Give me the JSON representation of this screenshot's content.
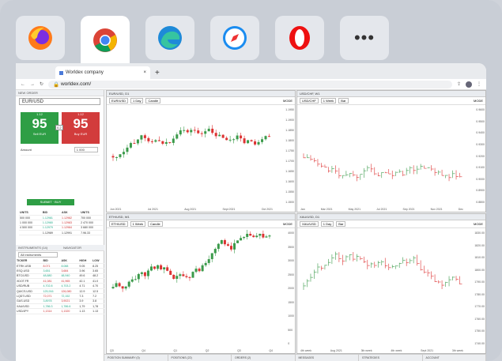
{
  "browser": {
    "tab_title": "Worldex company",
    "url": "worldex.com/"
  },
  "browsers": [
    "firefox",
    "chrome",
    "edge",
    "safari",
    "opera",
    "more"
  ],
  "order": {
    "header": "NEW ORDER",
    "symbol": "EUR/USD",
    "sell_price": "95",
    "buy_price": "95",
    "sell_prefix": "1.12",
    "buy_prefix": "1.12",
    "sell_label": "Sell EUR",
    "buy_label": "Buy EUR",
    "spread": "0.2",
    "amount_label": "Amount",
    "amount": "1 000",
    "submit": "SUBMIT · BUY"
  },
  "charts": [
    {
      "title": "EUR/USD, D1",
      "symbol": "EUR/USD",
      "tf": "1 Day",
      "type": "Candle",
      "mode": "MODE",
      "xlabels": [
        "Jun 2021",
        "Jul 2021",
        "Aug 2021",
        "Sept 2021",
        "Oct 2021"
      ],
      "ylabels": [
        "1.1950",
        "1.1900",
        "1.1850",
        "1.1800",
        "1.1750",
        "1.1700",
        "1.1650",
        "1.1600",
        "1.1550",
        "1.1500"
      ]
    },
    {
      "title": "USD/CHF, W1",
      "symbol": "USD/CHF",
      "tf": "1 Week",
      "type": "Bar",
      "mode": "MODE",
      "xlabels": [
        "Jan",
        "Mar 2021",
        "May 2021",
        "Jul 2021",
        "Sep 2021",
        "Nov 2021",
        "Dec"
      ],
      "ylabels": [
        "0.9600",
        "0.9500",
        "0.9400",
        "0.9300",
        "0.9200",
        "0.9100",
        "0.9000",
        "0.8900",
        "0.8800"
      ]
    },
    {
      "title": "ETH/USD, W1",
      "symbol": "ETH/USD",
      "tf": "1 Week",
      "type": "Candle",
      "mode": "MODE",
      "xlabels": [
        "Q3",
        "Q4",
        "Q1",
        "Q2",
        "Q3",
        "Q4"
      ],
      "ylabels": [
        "4000",
        "3500",
        "3000",
        "2500",
        "2000",
        "1500",
        "1000",
        "500",
        "0"
      ]
    },
    {
      "title": "XAU/USD, D1",
      "symbol": "XAU/USD",
      "tf": "1 Day",
      "type": "Bar",
      "mode": "MODE",
      "xlabels": [
        "4th week",
        "Aug 2021",
        "3th week",
        "4th week",
        "Sept 2021",
        "3th week"
      ],
      "ylabels": [
        "1830.00",
        "1820.00",
        "1810.00",
        "1800.00",
        "1790.00",
        "1780.00",
        "1770.00",
        "1760.00",
        "1750.00",
        "1740.00"
      ]
    }
  ],
  "instruments": {
    "header": "INSTRUMENTS (14)",
    "nav": "NAVIGATOR",
    "filter": "All instruments",
    "cols": [
      "TICKER",
      "BID",
      "ASK",
      "HIGH",
      "LOW"
    ],
    "rows": [
      [
        "ETRK.USB",
        "8.071",
        "8.088",
        "9.05",
        "8.25"
      ],
      [
        "ESQ.USD",
        "3,651",
        "3,684",
        "3.96",
        "3.65"
      ],
      [
        "BTC/USD",
        "48,880",
        "48,940",
        "49.6",
        "48.2"
      ],
      [
        "XDOT.FR",
        "41,081",
        "41,965",
        "42.1",
        "41.0"
      ],
      [
        "USD/RUB",
        "4,702.8",
        "4,703.2",
        "4.71",
        "4.70"
      ],
      [
        "QUICS.USD",
        "125,916",
        "126,080",
        "12.9",
        "12.5"
      ],
      [
        "LQDT.USD",
        "72,071",
        "72,152",
        "7.3",
        "7.2"
      ],
      [
        "GAS.USD",
        "3,8978",
        "3,9021",
        "3.9",
        "3.8"
      ],
      [
        "XAU/USD",
        "1,786.3",
        "1,786.6",
        "1,79",
        "1,78"
      ],
      [
        "USD/JPY",
        "1,1314",
        "1,1320",
        "1.13",
        "1.13"
      ]
    ]
  },
  "depth": {
    "cols": [
      "UNITS",
      "BID",
      "ASK",
      "UNITS"
    ],
    "rows": [
      [
        "500 000",
        "1.12981",
        "1.12982",
        "700 000"
      ],
      [
        "1 000 000",
        "1.12980",
        "1.12983",
        "2 470 000"
      ],
      [
        "4 500 000",
        "1.12979",
        "1.12984",
        "3 680 000"
      ]
    ],
    "total": [
      "1.12989",
      "1.12991",
      "7.96.33"
    ]
  },
  "bottom_tabs": [
    "POSITION SUMMARY (0)",
    "POSITIONS (22)",
    "ORDERS (2)",
    "MESSAGES",
    "STRATEGIES",
    "ACCOUNT"
  ]
}
